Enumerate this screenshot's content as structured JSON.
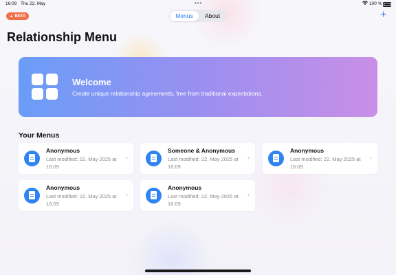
{
  "status_bar": {
    "time": "16:09",
    "date": "Thu 22. May",
    "dots": "•••",
    "battery_pct": "100 %"
  },
  "badge": {
    "label": "BETA",
    "color": "#f0704a"
  },
  "nav": {
    "tabs": [
      {
        "label": "Menus",
        "active": true
      },
      {
        "label": "About",
        "active": false
      }
    ],
    "add_icon": "plus-icon"
  },
  "page_title": "Relationship Menu",
  "banner": {
    "icon": "grid-icon",
    "title": "Welcome",
    "subtitle": "Create unique relationship agreements, free from traditional expectations."
  },
  "section_title": "Your Menus",
  "menus": [
    {
      "name": "Anonymous",
      "modified": "Last modified: 22. May 2025 at 16:09"
    },
    {
      "name": "Someone & Anonymous",
      "modified": "Last modified: 22. May 2025 at 16:09"
    },
    {
      "name": "Anonymous",
      "modified": "Last modified: 22. May 2025 at 16:09"
    },
    {
      "name": "Anonymous",
      "modified": "Last modified: 22. May 2025 at 16:09"
    },
    {
      "name": "Anonymous",
      "modified": "Last modified: 22. May 2025 at 16:09"
    }
  ],
  "colors": {
    "accent": "#2d7df6",
    "banner_gradient_start": "#6a9df7",
    "banner_gradient_end": "#c98fe6"
  }
}
